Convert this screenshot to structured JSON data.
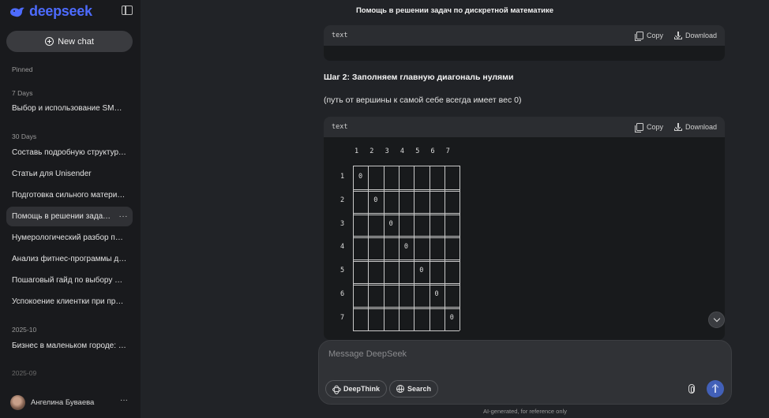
{
  "sidebar": {
    "logo_text": "deepseek",
    "new_chat_label": "New chat",
    "sections": {
      "pinned": "Pinned",
      "seven_days": "7 Days",
      "thirty_days": "30 Days",
      "month_2025_10": "2025-10",
      "month_2025_09": "2025-09"
    },
    "chats": {
      "seven_days": [
        "Выбор и использование SMART-целей"
      ],
      "thirty_days": [
        "Составь подробную структуру статьи",
        "Статьи для Unisender",
        "Подготовка сильного материала",
        "Помощь в решении задач по дискретной математике",
        "Нумерологический разбор по дате",
        "Анализ фитнес-программы для клиента",
        "Пошаговый гайд по выбору фреймворка",
        "Успокоение клиентки при просрочке"
      ],
      "month_2025_10": [
        "Бизнес в маленьком городе: возможности"
      ]
    },
    "more_glyph": "···",
    "user_name": "Ангелина Буваева"
  },
  "main": {
    "page_title": "Помощь в решении задач по дискретной математике",
    "code_blocks": [
      {
        "lang": "text",
        "copy_label": "Copy",
        "download_label": "Download"
      },
      {
        "lang": "text",
        "copy_label": "Copy",
        "download_label": "Download"
      }
    ],
    "step_heading": "Шаг 2: Заполняем главную диагональ нулями",
    "step_text": "(путь от вершины к самой себе всегда имеет вес 0)",
    "matrix": {
      "column_headers": [
        "1",
        "2",
        "3",
        "4",
        "5",
        "6",
        "7"
      ],
      "row_headers": [
        "1",
        "2",
        "3",
        "4",
        "5",
        "6",
        "7"
      ],
      "diagonal_value": "0"
    }
  },
  "composer": {
    "placeholder": "Message DeepSeek",
    "deepthink_label": "DeepThink",
    "search_label": "Search"
  },
  "footer_note": "AI-generated, for reference only",
  "colors": {
    "accent": "#4d6bfe",
    "send_button": "#4260b8",
    "background": "#212327",
    "sidebar": "#191a1d"
  }
}
